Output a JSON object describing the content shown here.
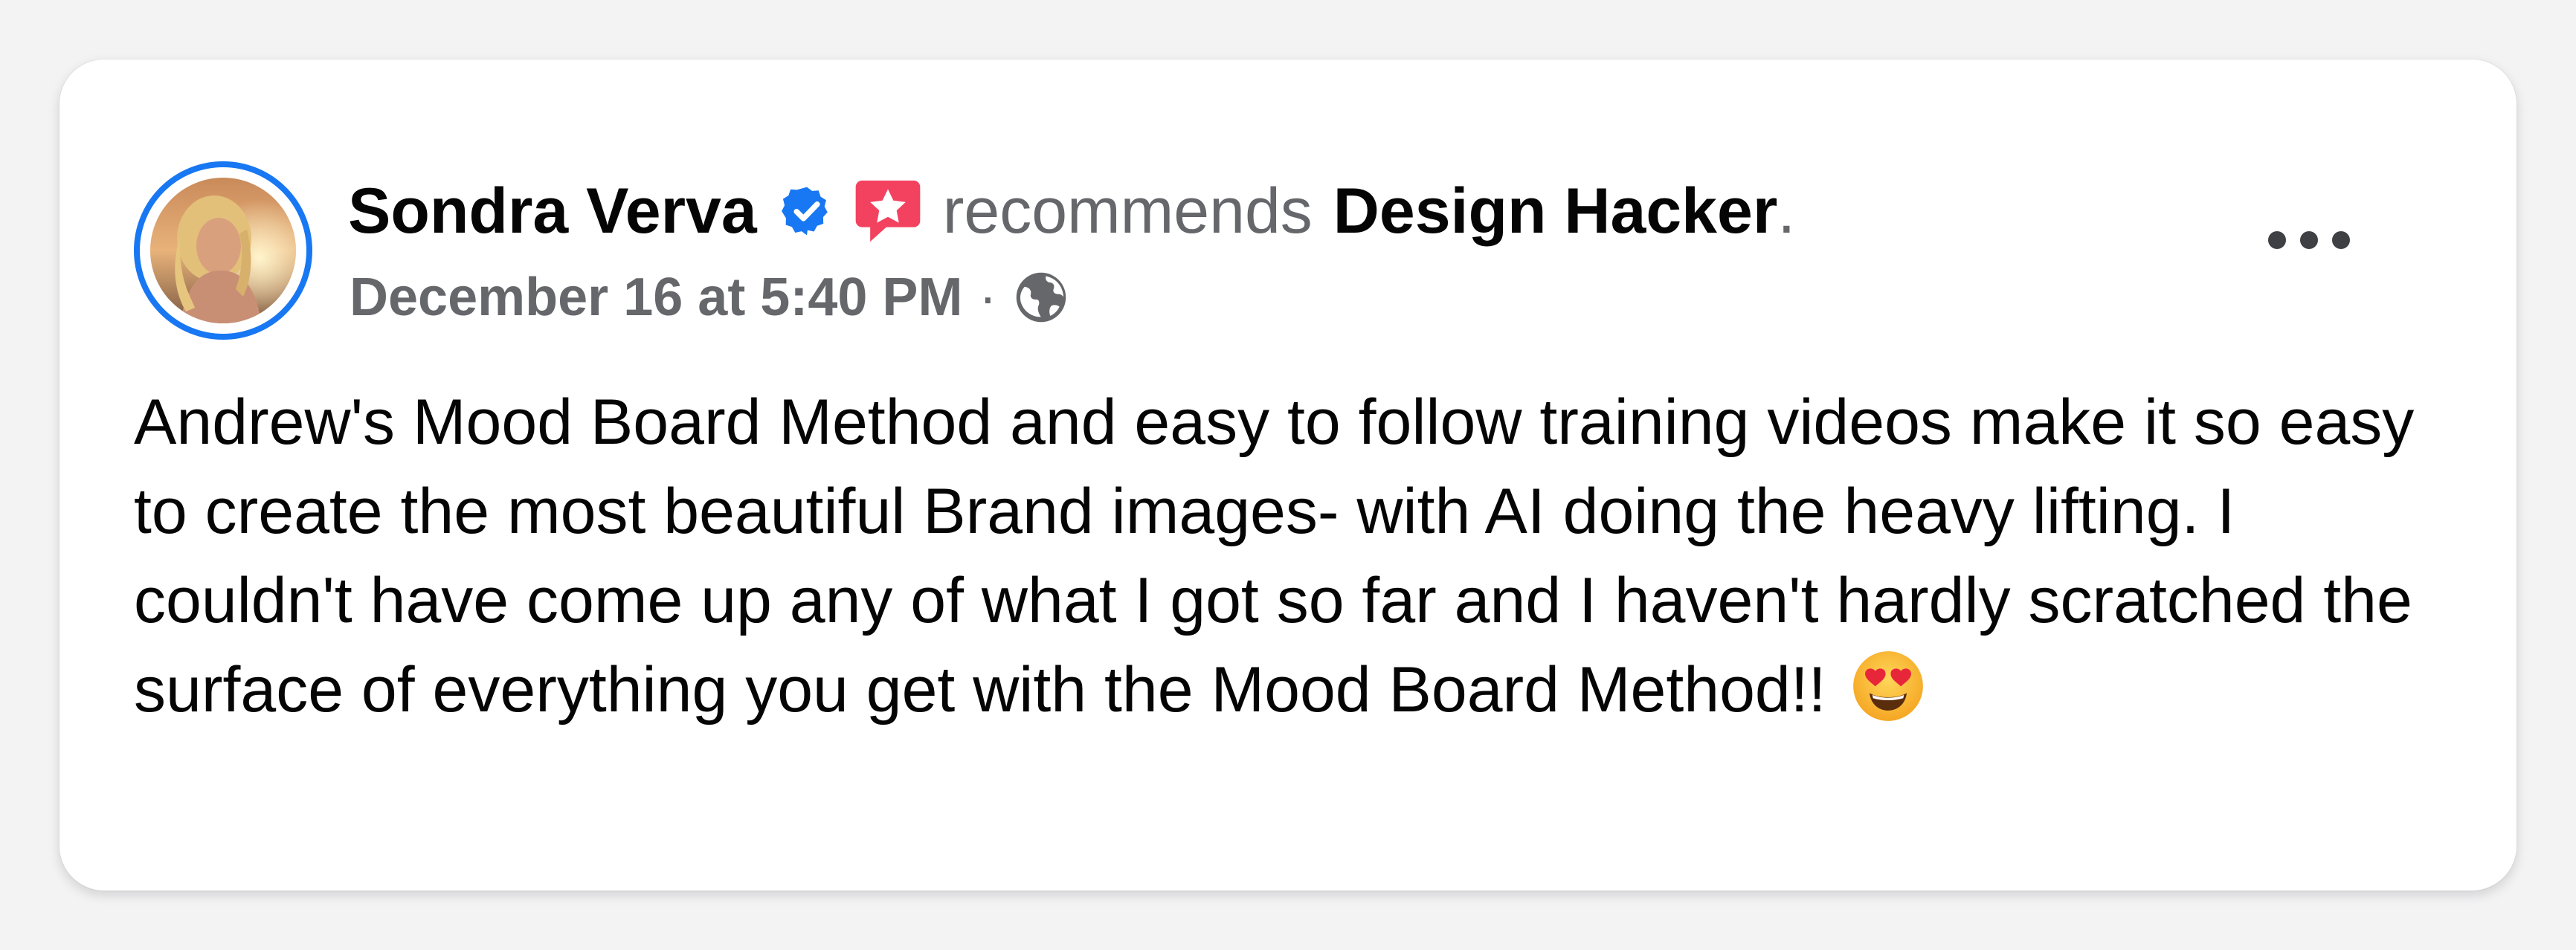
{
  "post": {
    "author": "Sondra Verva",
    "action": "recommends",
    "page_name": "Design Hacker",
    "end_punct": ".",
    "timestamp": "December 16 at 5:40 PM",
    "meta_separator": "·",
    "privacy_icon": "globe-icon",
    "verified_icon": "verified-badge-icon",
    "recommend_icon": "recommendation-star-icon",
    "menu_icon": "more-options-icon",
    "body": "Andrew's Mood Board Method and easy to follow training videos make it so easy to create the most beautiful Brand images- with AI doing the heavy lifting. I couldn't have come up any of what I got so far and I haven't hardly scratched the surface of everything you get with the Mood Board Method!!",
    "emoji": "heart-eyes-emoji"
  },
  "colors": {
    "accent_blue": "#1877f2",
    "recommend_red": "#f3425f",
    "secondary_text": "#65676b",
    "primary_text": "#050505"
  }
}
